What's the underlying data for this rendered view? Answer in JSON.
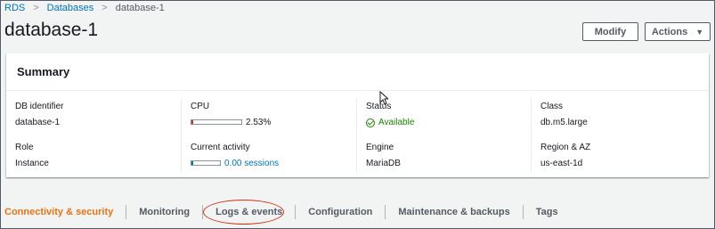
{
  "breadcrumb": {
    "items": [
      "RDS",
      "Databases",
      "database-1"
    ],
    "separator": ">"
  },
  "page": {
    "title": "database-1"
  },
  "toolbar": {
    "modify_label": "Modify",
    "actions_label": "Actions",
    "actions_caret": "▼"
  },
  "summary": {
    "title": "Summary",
    "db_identifier": {
      "label": "DB identifier",
      "value": "database-1"
    },
    "role": {
      "label": "Role",
      "value": "Instance"
    },
    "cpu": {
      "label": "CPU",
      "value": "2.53%",
      "percent": 2.53
    },
    "current_activity": {
      "label": "Current activity",
      "value": "0.00 sessions"
    },
    "status": {
      "label": "Status",
      "value": "Available"
    },
    "engine": {
      "label": "Engine",
      "value": "MariaDB"
    },
    "class": {
      "label": "Class",
      "value": "db.m5.large"
    },
    "region": {
      "label": "Region & AZ",
      "value": "us-east-1d"
    }
  },
  "tabs": {
    "items": [
      "Connectivity & security",
      "Monitoring",
      "Logs & events",
      "Configuration",
      "Maintenance & backups",
      "Tags"
    ],
    "active": "Connectivity & security",
    "highlighted": "Logs & events"
  },
  "colors": {
    "link": "#0073bb",
    "active_tab": "#ec7211",
    "available": "#1d8102",
    "highlight_circle": "#d13212"
  }
}
